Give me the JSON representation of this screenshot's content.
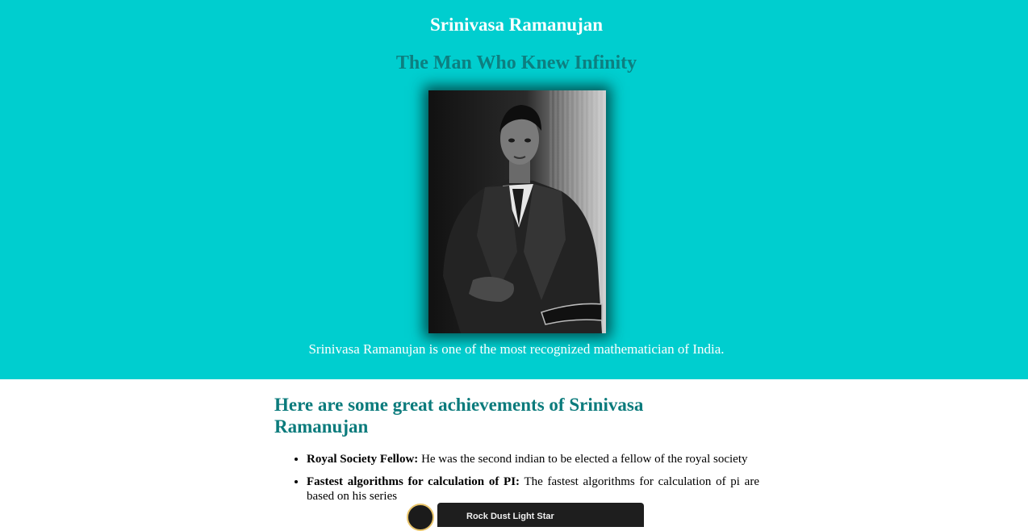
{
  "hero": {
    "title": "Srinivasa Ramanujan",
    "subtitle": "The Man Who Knew Infinity",
    "caption": "Srinivasa Ramanujan is one of the most recognized mathematician of India.",
    "background_color": "#00cecf"
  },
  "main": {
    "heading": "Here are some great achievements of Srinivasa Ramanujan",
    "achievements": [
      {
        "title": "Royal Society Fellow:",
        "text": " He was the second indian to be elected a fellow of the royal society"
      },
      {
        "title": "Fastest algorithms for calculation of PI:",
        "text": " The fastest algorithms for calculation of pi are based on his series"
      }
    ]
  },
  "media_player": {
    "text": "Rock Dust Light Star"
  }
}
